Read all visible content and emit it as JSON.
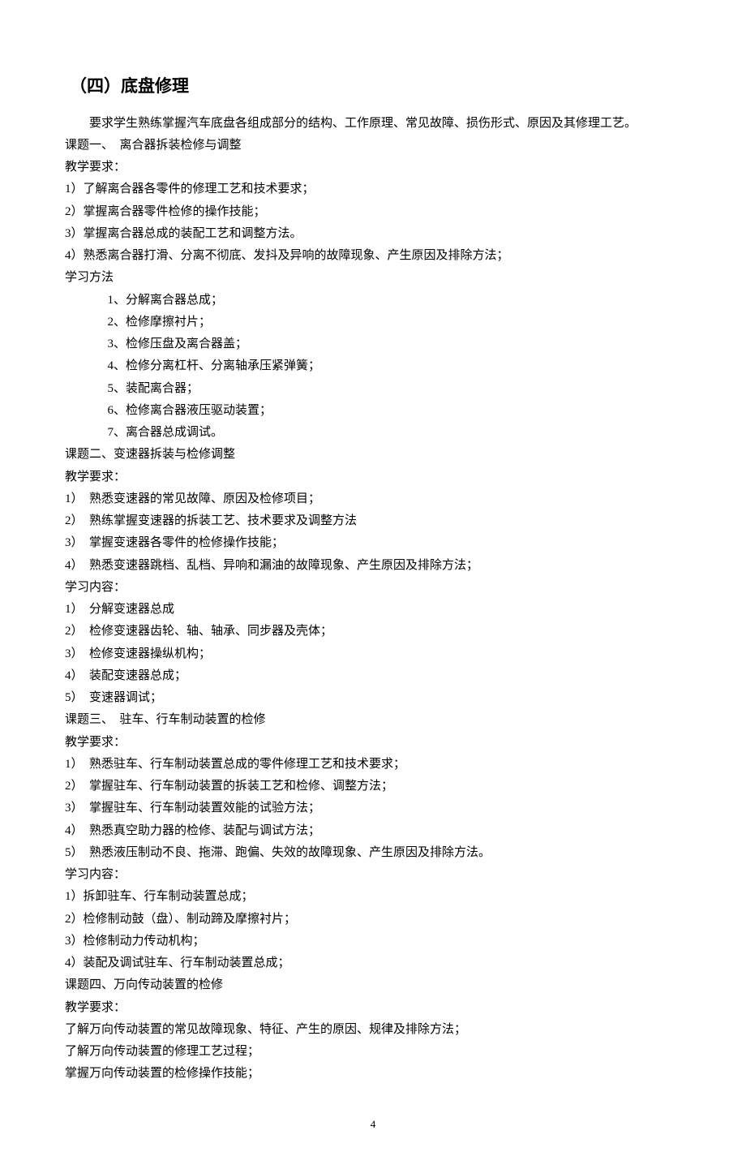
{
  "heading": "（四）底盘修理",
  "intro": "要求学生熟练掌握汽车底盘各组成部分的结构、工作原理、常见故障、损伤形式、原因及其修理工艺。",
  "topic1": {
    "title": "课题一、　离合器拆装检修与调整",
    "req_label": "教学要求：",
    "reqs": [
      "1）了解离合器各零件的修理工艺和技术要求；",
      "2）掌握离合器零件检修的操作技能；",
      "3）掌握离合器总成的装配工艺和调整方法。",
      "4）熟悉离合器打滑、分离不彻底、发抖及异响的故障现象、产生原因及排除方法；"
    ],
    "method_label": "学习方法",
    "methods": [
      "1、分解离合器总成；",
      "2、检修摩擦衬片；",
      "3、检修压盘及离合器盖；",
      "4、检修分离杠杆、分离轴承压紧弹簧；",
      "5、装配离合器；",
      "6、检修离合器液压驱动装置；",
      "7、离合器总成调试。"
    ]
  },
  "topic2": {
    "title": "课题二、变速器拆装与检修调整",
    "req_label": "教学要求：",
    "reqs": [
      "1）　熟悉变速器的常见故障、原因及检修项目；",
      "2）　熟练掌握变速器的拆装工艺、技术要求及调整方法",
      "3）　掌握变速器各零件的检修操作技能；",
      "4）　熟悉变速器跳档、乱档、异响和漏油的故障现象、产生原因及排除方法；"
    ],
    "content_label": "学习内容：",
    "contents": [
      "1）　分解变速器总成",
      "2）　检修变速器齿轮、轴、轴承、同步器及壳体；",
      "3）　检修变速器操纵机构；",
      "4）　装配变速器总成；",
      "5）　变速器调试；"
    ]
  },
  "topic3": {
    "title": "课题三、　驻车、行车制动装置的检修",
    "req_label": "教学要求：",
    "reqs": [
      "1）　熟悉驻车、行车制动装置总成的零件修理工艺和技术要求；",
      "2）　掌握驻车、行车制动装置的拆装工艺和检修、调整方法；",
      "3）　掌握驻车、行车制动装置效能的试验方法；",
      "4）　熟悉真空助力器的检修、装配与调试方法；",
      "5）　熟悉液压制动不良、拖滞、跑偏、失效的故障现象、产生原因及排除方法。"
    ],
    "content_label": "学习内容：",
    "contents": [
      "1）拆卸驻车、行车制动装置总成；",
      "2）检修制动鼓（盘）、制动蹄及摩擦衬片；",
      "3）检修制动力传动机构；",
      "4）装配及调试驻车、行车制动装置总成；"
    ]
  },
  "topic4": {
    "title": "课题四、万向传动装置的检修",
    "req_label": "教学要求：",
    "reqs": [
      "了解万向传动装置的常见故障现象、特征、产生的原因、规律及排除方法；",
      "了解万向传动装置的修理工艺过程；",
      "掌握万向传动装置的检修操作技能；"
    ]
  },
  "page_number": "4"
}
